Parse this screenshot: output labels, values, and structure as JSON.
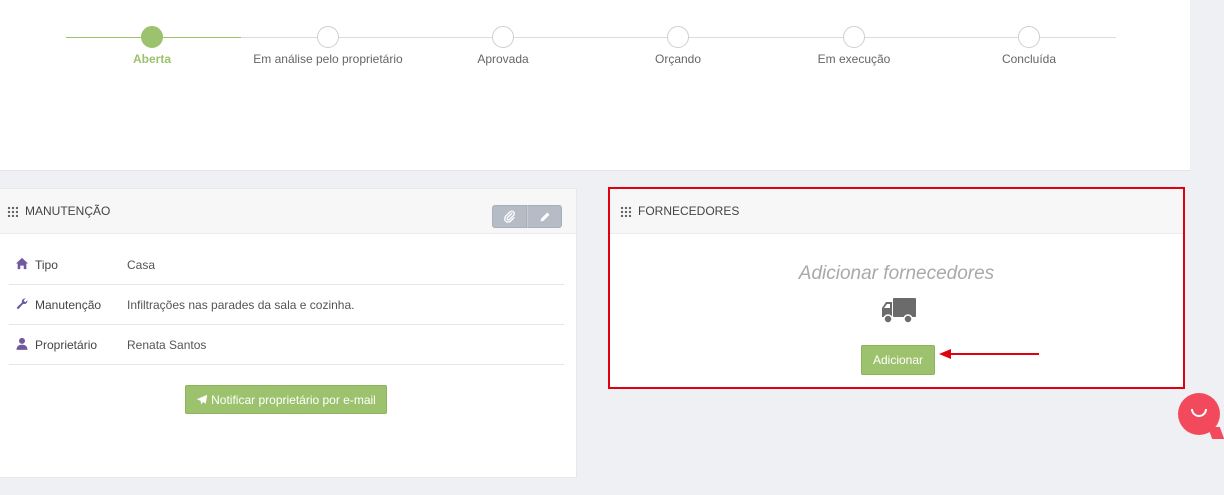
{
  "progress": {
    "steps": [
      {
        "label": "Aberta",
        "active": true
      },
      {
        "label": "Em análise pelo proprietário",
        "active": false
      },
      {
        "label": "Aprovada",
        "active": false
      },
      {
        "label": "Orçando",
        "active": false
      },
      {
        "label": "Em execução",
        "active": false
      },
      {
        "label": "Concluída",
        "active": false
      }
    ]
  },
  "maintenance": {
    "title": "MANUTENÇÃO",
    "rows": [
      {
        "icon": "home-icon",
        "key": "Tipo",
        "value": "Casa"
      },
      {
        "icon": "wrench-icon",
        "key": "Manutenção",
        "value": "Infiltrações nas parades da sala e cozinha."
      },
      {
        "icon": "user-icon",
        "key": "Proprietário",
        "value": "Renata Santos"
      }
    ],
    "actions": {
      "attach_icon": "paperclip-icon",
      "edit_icon": "pencil-icon"
    },
    "notify_label": "Notificar proprietário por e-mail",
    "notify_icon": "paper-plane-icon"
  },
  "suppliers": {
    "title": "FORNECEDORES",
    "empty_text": "Adicionar fornecedores",
    "empty_icon": "truck-icon",
    "add_label": "Adicionar"
  },
  "colors": {
    "accent_green": "#9dc26e",
    "highlight_red": "#e0000f",
    "icon_purple": "#6f5aa0",
    "chat_pink": "#f2495c"
  },
  "chat": {
    "icon": "chat-bubble-icon"
  }
}
